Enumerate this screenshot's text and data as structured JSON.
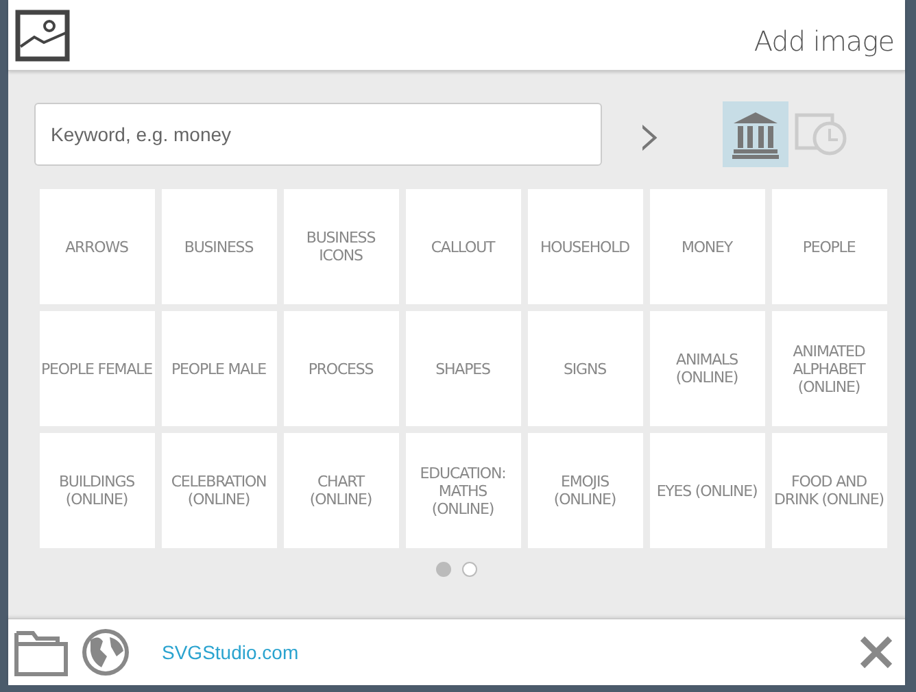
{
  "header": {
    "title": "Add image"
  },
  "search": {
    "placeholder": "Keyword, e.g. money",
    "go": "›"
  },
  "sources": [
    {
      "kind": "library",
      "selected": true
    },
    {
      "kind": "recent",
      "selected": false
    }
  ],
  "categories": [
    {
      "label": "ARROWS"
    },
    {
      "label": "BUSINESS"
    },
    {
      "label": "BUSINESS ICONS"
    },
    {
      "label": "CALLOUT"
    },
    {
      "label": "HOUSEHOLD"
    },
    {
      "label": "MONEY"
    },
    {
      "label": "PEOPLE"
    },
    {
      "label": "PEOPLE FEMALE"
    },
    {
      "label": "PEOPLE MALE"
    },
    {
      "label": "PROCESS"
    },
    {
      "label": "SHAPES"
    },
    {
      "label": "SIGNS"
    },
    {
      "label": "ANIMALS (ONLINE)"
    },
    {
      "label": "ANIMATED ALPHABET (ONLINE)"
    },
    {
      "label": "BUILDINGS (ONLINE)"
    },
    {
      "label": "CELEBRATION (ONLINE)"
    },
    {
      "label": "CHART (ONLINE)"
    },
    {
      "label": "EDUCATION: MATHS (ONLINE)"
    },
    {
      "label": "EMOJIS (ONLINE)"
    },
    {
      "label": "EYES (ONLINE)"
    },
    {
      "label": "FOOD AND DRINK (ONLINE)"
    }
  ],
  "pages": [
    {
      "selected": true
    },
    {
      "selected": false
    }
  ],
  "footer": {
    "link": "SVGStudio.com"
  }
}
